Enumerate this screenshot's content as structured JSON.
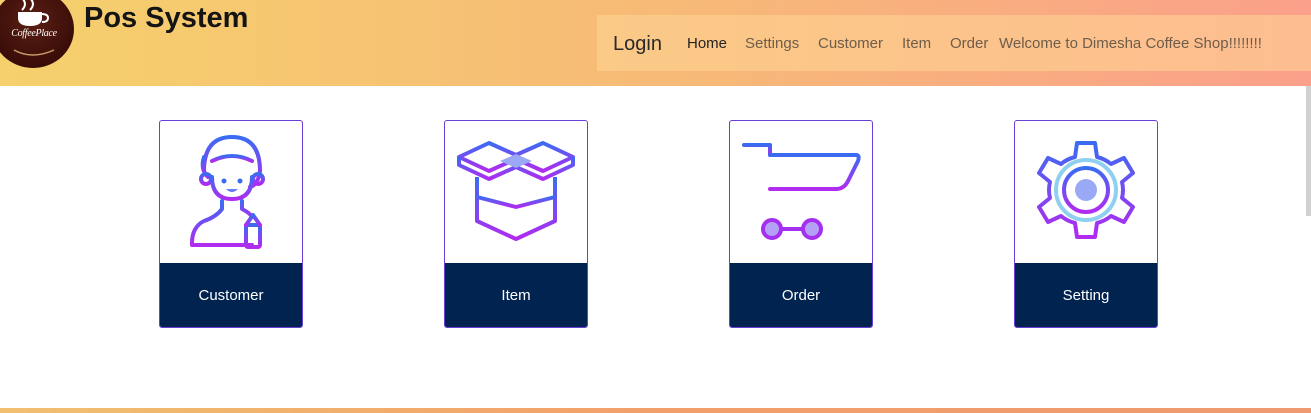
{
  "header": {
    "logo_text": "CoffeePlace",
    "title": "Pos System"
  },
  "navbar": {
    "brand": "Login",
    "links": [
      "Home",
      "Settings",
      "Customer",
      "Item",
      "Order"
    ],
    "welcome": "Welcome to Dimesha Coffee Shop!!!!!!!!"
  },
  "cards": [
    {
      "label": "Customer",
      "icon": "customer-icon"
    },
    {
      "label": "Item",
      "icon": "box-icon"
    },
    {
      "label": "Order",
      "icon": "cart-icon"
    },
    {
      "label": "Setting",
      "icon": "gear-icon"
    }
  ],
  "colors": {
    "header_gradient_start": "#f5d06c",
    "header_gradient_end": "#fba08a",
    "card_footer": "#002350",
    "card_border": "#6a3fd6",
    "icon_gradient_top": "#3a6cf2",
    "icon_gradient_bottom": "#b12bf0"
  }
}
